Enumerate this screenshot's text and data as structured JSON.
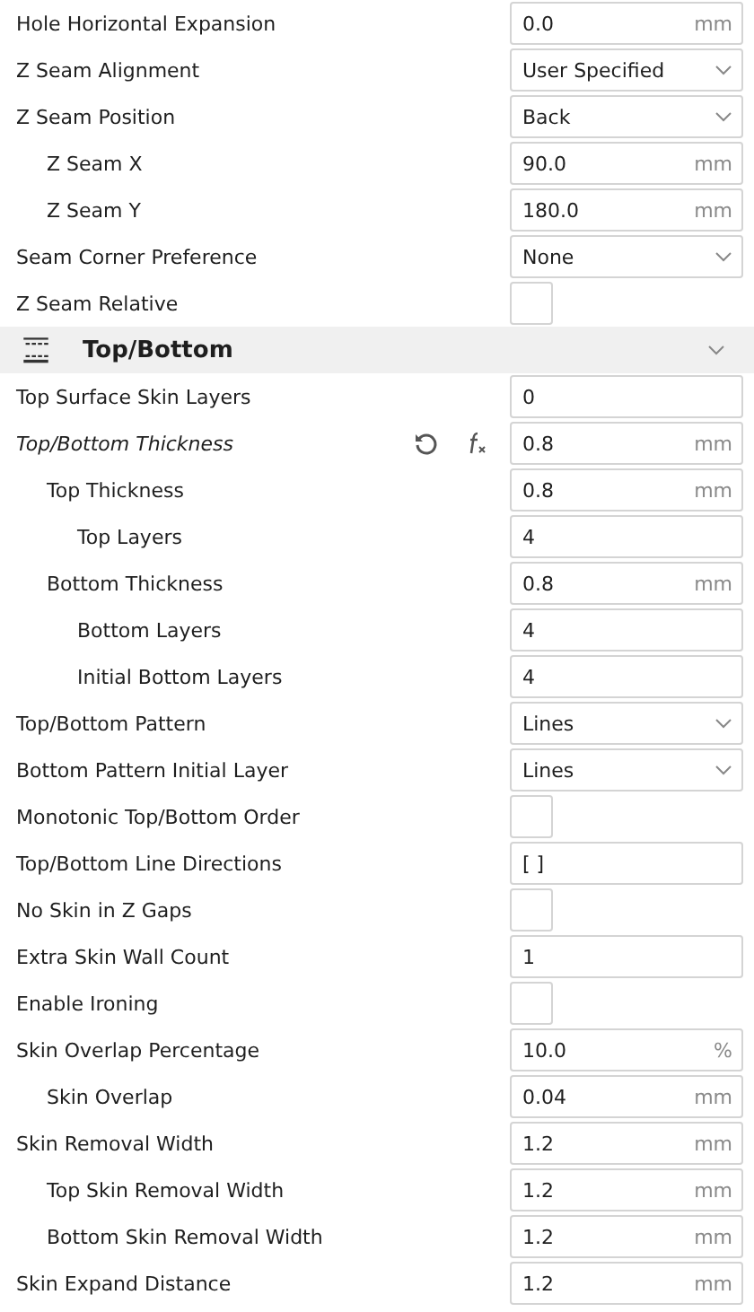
{
  "settings": [
    {
      "label": "Hole Horizontal Expansion",
      "kind": "input",
      "value": "0.0",
      "unit": "mm"
    },
    {
      "label": "Z Seam Alignment",
      "kind": "dropdown",
      "value": "User Specified"
    },
    {
      "label": "Z Seam Position",
      "kind": "dropdown",
      "value": "Back",
      "children": [
        {
          "label": "Z Seam X",
          "kind": "input",
          "value": "90.0",
          "unit": "mm"
        },
        {
          "label": "Z Seam Y",
          "kind": "input",
          "value": "180.0",
          "unit": "mm"
        }
      ]
    },
    {
      "label": "Seam Corner Preference",
      "kind": "dropdown",
      "value": "None"
    },
    {
      "label": "Z Seam Relative",
      "kind": "checkbox",
      "checked": false
    },
    {
      "label": "Top/Bottom",
      "kind": "section",
      "expanded": true
    },
    {
      "label": "Top Surface Skin Layers",
      "kind": "input",
      "value": "0"
    },
    {
      "label": "Top/Bottom Thickness",
      "kind": "input",
      "value": "0.8",
      "unit": "mm",
      "overridden": true,
      "children": [
        {
          "label": "Top Thickness",
          "kind": "input",
          "value": "0.8",
          "unit": "mm",
          "children": [
            {
              "label": "Top Layers",
              "kind": "input",
              "value": "4"
            }
          ]
        },
        {
          "label": "Bottom Thickness",
          "kind": "input",
          "value": "0.8",
          "unit": "mm",
          "children": [
            {
              "label": "Bottom Layers",
              "kind": "input",
              "value": "4"
            },
            {
              "label": "Initial Bottom Layers",
              "kind": "input",
              "value": "4"
            }
          ]
        }
      ]
    },
    {
      "label": "Top/Bottom Pattern",
      "kind": "dropdown",
      "value": "Lines"
    },
    {
      "label": "Bottom Pattern Initial Layer",
      "kind": "dropdown",
      "value": "Lines"
    },
    {
      "label": "Monotonic Top/Bottom Order",
      "kind": "checkbox",
      "checked": false
    },
    {
      "label": "Top/Bottom Line Directions",
      "kind": "input",
      "value": "[ ]"
    },
    {
      "label": "No Skin in Z Gaps",
      "kind": "checkbox",
      "checked": false
    },
    {
      "label": "Extra Skin Wall Count",
      "kind": "input",
      "value": "1"
    },
    {
      "label": "Enable Ironing",
      "kind": "checkbox",
      "checked": false
    },
    {
      "label": "Skin Overlap Percentage",
      "kind": "input",
      "value": "10.0",
      "unit": "%",
      "children": [
        {
          "label": "Skin Overlap",
          "kind": "input",
          "value": "0.04",
          "unit": "mm"
        }
      ]
    },
    {
      "label": "Skin Removal Width",
      "kind": "input",
      "value": "1.2",
      "unit": "mm",
      "children": [
        {
          "label": "Top Skin Removal Width",
          "kind": "input",
          "value": "1.2",
          "unit": "mm"
        },
        {
          "label": "Bottom Skin Removal Width",
          "kind": "input",
          "value": "1.2",
          "unit": "mm"
        }
      ]
    },
    {
      "label": "Skin Expand Distance",
      "kind": "input",
      "value": "1.2",
      "unit": "mm"
    }
  ]
}
